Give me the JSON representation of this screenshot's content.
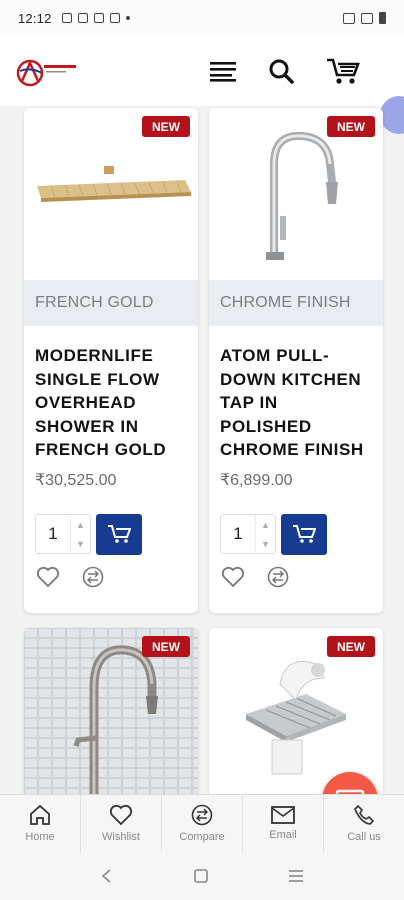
{
  "status_bar": {
    "time": "12:12"
  },
  "header": {
    "logo_alt": "Amanita",
    "icons": [
      "menu-icon",
      "search-icon",
      "cart-icon"
    ]
  },
  "products": [
    {
      "badge": "NEW",
      "finish": "FRENCH GOLD",
      "title": "MODERNLIFE SINGLE FLOW OVERHEAD SHOWER IN FRENCH GOLD",
      "price": "₹30,525.00",
      "qty": "1"
    },
    {
      "badge": "NEW",
      "finish": "CHROME FINISH",
      "title": "ATOM PULL-DOWN KITCHEN TAP IN POLISHED CHROME FINISH",
      "price": "₹6,899.00",
      "qty": "1"
    },
    {
      "badge": "NEW"
    },
    {
      "badge": "NEW"
    }
  ],
  "bottom_nav": {
    "home": "Home",
    "wishlist": "Wishlist",
    "compare": "Compare",
    "email": "Email",
    "call": "Call us"
  },
  "colors": {
    "accent": "#183b92",
    "badge": "#b3121a",
    "fab": "#f25a45"
  }
}
